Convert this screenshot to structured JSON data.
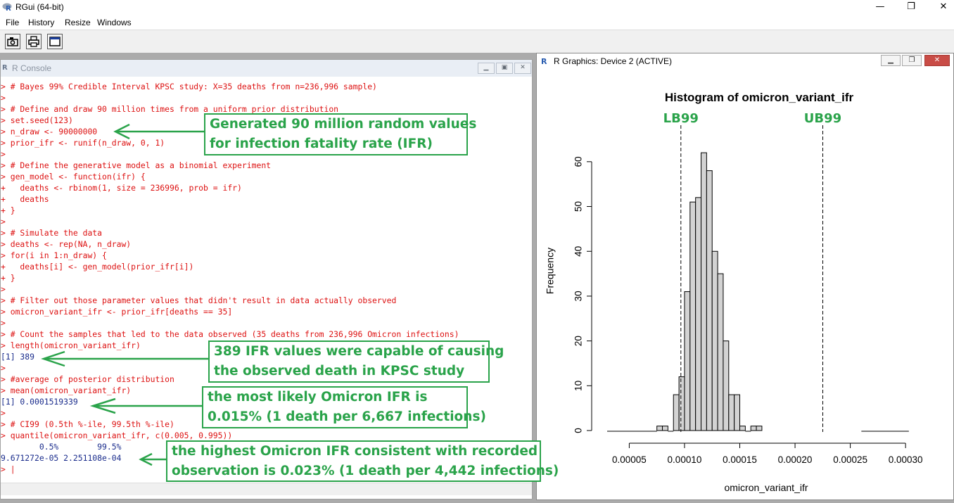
{
  "window": {
    "title": "RGui (64-bit)",
    "controls": {
      "minimize": "—",
      "restore": "❐",
      "close": "✕"
    }
  },
  "menu": [
    "File",
    "History",
    "Resize",
    "Windows"
  ],
  "toolbar": {
    "icons": [
      "camera-icon",
      "print-icon",
      "window-icon"
    ]
  },
  "console": {
    "title": "R Console",
    "lines": [
      "> # Bayes 99% Credible Interval KPSC study: X=35 deaths from n=236,996 sample)",
      ">",
      "> # Define and draw 90 million times from a uniform prior distribution",
      "> set.seed(123)",
      "> n_draw <- 90000000",
      "> prior_ifr <- runif(n_draw, 0, 1)",
      ">",
      "> # Define the generative model as a binomial experiment",
      "> gen_model <- function(ifr) {",
      "+   deaths <- rbinom(1, size = 236996, prob = ifr)",
      "+   deaths",
      "+ }",
      ">",
      "> # Simulate the data",
      "> deaths <- rep(NA, n_draw)",
      "> for(i in 1:n_draw) {",
      "+   deaths[i] <- gen_model(prior_ifr[i])",
      "+ }",
      ">",
      "> # Filter out those parameter values that didn't result in data actually observed",
      "> omicron_variant_ifr <- prior_ifr[deaths == 35]",
      ">",
      "> # Count the samples that led to the data observed (35 deaths from 236,996 Omicron infections)",
      "> length(omicron_variant_ifr)",
      "[1] 389",
      ">",
      "> #average of posterior distribution",
      "> mean(omicron_variant_ifr)",
      "[1] 0.0001519339",
      ">",
      "> # CI99 (0.5th %-ile, 99.5th %-ile)",
      "> quantile(omicron_variant_ifr, c(0.005, 0.995))",
      "        0.5%        99.5% ",
      "9.671272e-05 2.251108e-04 ",
      "> |"
    ]
  },
  "graphics": {
    "title": "R Graphics: Device 2 (ACTIVE)"
  },
  "chart_data": {
    "type": "bar",
    "title": "Histogram of omicron_variant_ifr",
    "xlabel": "omicron_variant_ifr",
    "ylabel": "Frequency",
    "bin_width": 1e-05,
    "bin_starts": [
      7.5e-05,
      8e-05,
      8.5e-05,
      9e-05,
      9.5e-05,
      0.0001,
      0.000105,
      0.00011,
      0.000115,
      0.00012,
      0.000125,
      0.00013,
      0.000135,
      0.00014,
      0.000145,
      0.00015,
      0.000155,
      0.00016,
      0.000165,
      0.00017,
      0.000175,
      0.00018,
      0.000185,
      0.00019,
      0.000195,
      0.0002,
      0.000205,
      0.00021,
      0.000215,
      0.00022,
      0.000225,
      0.00023,
      0.000235,
      0.00024,
      0.000245,
      0.00025,
      0.000255,
      0.00026,
      0.000265,
      0.00027,
      0.000275,
      0.00028,
      0.000285,
      0.00029,
      0.000295
    ],
    "values": [
      1,
      1,
      0,
      8,
      12,
      31,
      51,
      52,
      62,
      58,
      40,
      35,
      20,
      8,
      8,
      1,
      0,
      1,
      1
    ],
    "bins_start": 7.5e-05,
    "bins_step": 5e-06,
    "xticks": [
      "0.00005",
      "0.00010",
      "0.00015",
      "0.00020",
      "0.00025",
      "0.00030"
    ],
    "xtick_values": [
      5e-05,
      0.0001,
      0.00015,
      0.0002,
      0.00025,
      0.0003
    ],
    "yticks": [
      "0",
      "10",
      "20",
      "30",
      "40",
      "50",
      "60"
    ],
    "ylim": [
      0,
      65
    ],
    "xlim": [
      3e-05,
      0.000305
    ],
    "vlines": [
      {
        "label": "LB99",
        "x": 9.671272e-05
      },
      {
        "label": "UB99",
        "x": 0.0002251108
      }
    ],
    "vline_color": "#2aa34a"
  },
  "annotations": [
    {
      "name": "callout-90-million",
      "lines": [
        "Generated 90 million random values",
        "for infection fatality rate (IFR)"
      ]
    },
    {
      "name": "callout-389-values",
      "lines": [
        "389 IFR values were capable of causing",
        "the observed death in KPSC study"
      ]
    },
    {
      "name": "callout-mean",
      "lines": [
        "the most likely Omicron IFR is",
        "0.015% (1 death per 6,667 infections)"
      ]
    },
    {
      "name": "callout-upper",
      "lines": [
        "the highest Omicron IFR consistent with recorded",
        "observation is 0.023% (1 death per 4,442 infections)"
      ]
    }
  ],
  "colors": {
    "code": "#dd1111",
    "output": "#1a2c8c",
    "accent": "#2aa34a"
  }
}
